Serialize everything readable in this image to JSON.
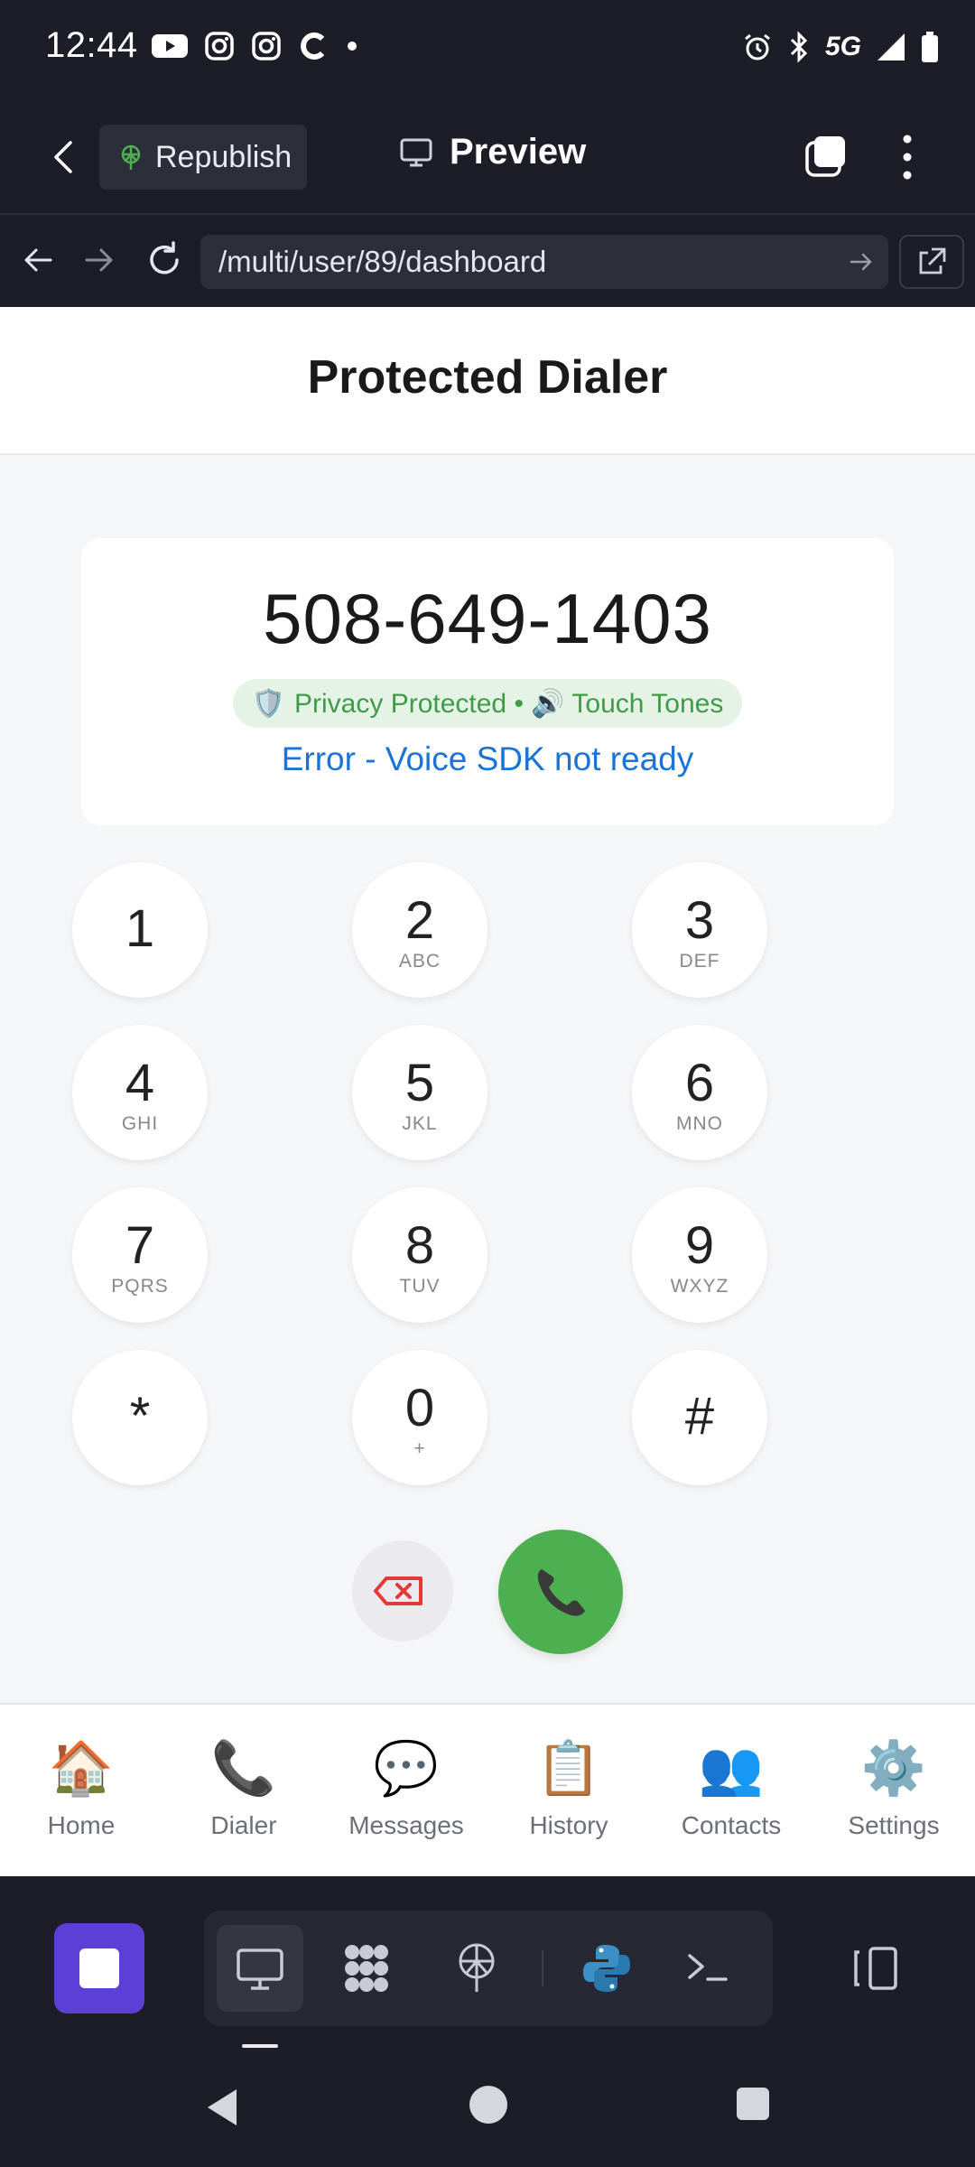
{
  "status_bar": {
    "time": "12:44",
    "network": "5G",
    "icons": [
      "youtube-icon",
      "instagram-icon",
      "instagram-icon",
      "c-app-icon",
      "dot-icon",
      "alarm-icon",
      "bluetooth-icon",
      "signal-icon",
      "battery-icon"
    ]
  },
  "app_header": {
    "republish_label": "Republish",
    "preview_label": "Preview"
  },
  "browser": {
    "url": "/multi/user/89/dashboard"
  },
  "page": {
    "title": "Protected Dialer"
  },
  "dialer": {
    "number": "508-649-1403",
    "badge_text": "Privacy Protected • 🔊 Touch Tones",
    "status": "Error - Voice SDK not ready",
    "keys": [
      {
        "digit": "1",
        "letters": ""
      },
      {
        "digit": "2",
        "letters": "ABC"
      },
      {
        "digit": "3",
        "letters": "DEF"
      },
      {
        "digit": "4",
        "letters": "GHI"
      },
      {
        "digit": "5",
        "letters": "JKL"
      },
      {
        "digit": "6",
        "letters": "MNO"
      },
      {
        "digit": "7",
        "letters": "PQRS"
      },
      {
        "digit": "8",
        "letters": "TUV"
      },
      {
        "digit": "9",
        "letters": "WXYZ"
      },
      {
        "digit": "*",
        "letters": ""
      },
      {
        "digit": "0",
        "letters": "+"
      },
      {
        "digit": "#",
        "letters": ""
      }
    ],
    "colors": {
      "call": "#4caf50",
      "delete": "#e53935",
      "status": "#1a73d8",
      "badge_text": "#3f9b46"
    }
  },
  "tab_nav": {
    "active": "Dialer",
    "items": [
      {
        "label": "Home",
        "icon": "🏠"
      },
      {
        "label": "Dialer",
        "icon": "📞"
      },
      {
        "label": "Messages",
        "icon": "💬"
      },
      {
        "label": "History",
        "icon": "📋"
      },
      {
        "label": "Contacts",
        "icon": "👥"
      },
      {
        "label": "Settings",
        "icon": "⚙️"
      }
    ]
  },
  "dev_toolbar": {
    "tools": [
      "monitor-icon",
      "grid-dots-icon",
      "publish-antenna-icon",
      "python-icon",
      "terminal-icon"
    ],
    "active_tool": "monitor-icon",
    "accent": "#5b3fd6"
  }
}
